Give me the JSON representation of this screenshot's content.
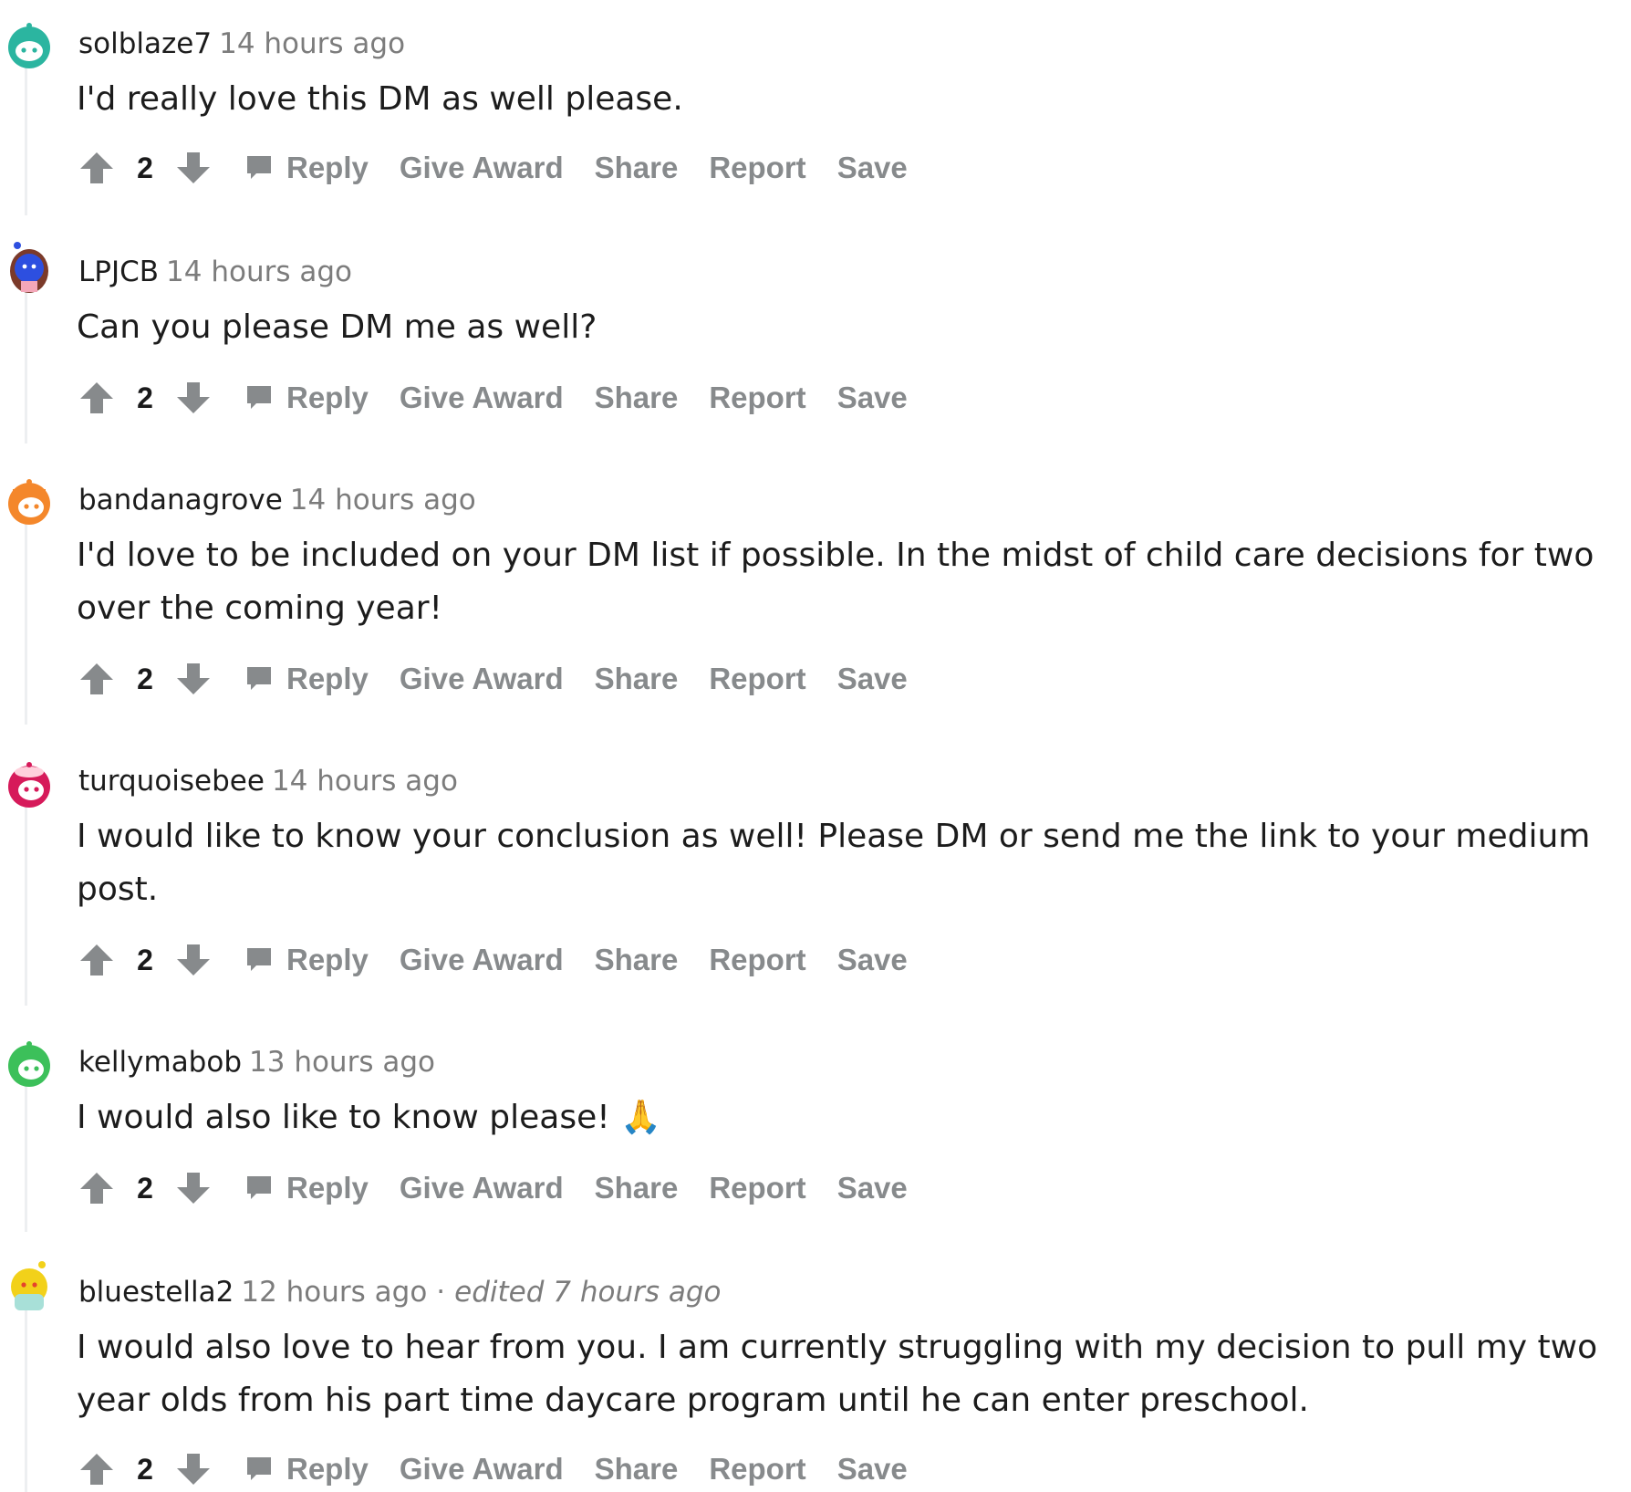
{
  "actions": {
    "reply": "Reply",
    "give_award": "Give Award",
    "share": "Share",
    "report": "Report",
    "save": "Save"
  },
  "comments": [
    {
      "author": "solblaze7",
      "time": "14 hours ago",
      "body_lines": [
        "I'd really love this DM as well please."
      ],
      "score": "2",
      "avatar_color": "#2bb5a0",
      "avatar_icon": "snoo-avatar-teal"
    },
    {
      "author": "LPJCB",
      "time": "14 hours ago",
      "body_lines": [
        "Can you please DM me as well?"
      ],
      "score": "2",
      "avatar_color": "#2d4fe0",
      "avatar_icon": "snoo-avatar-blue"
    },
    {
      "author": "bandanagrove",
      "time": "14 hours ago",
      "body_lines": [
        "I'd love to be included on your DM list if possible. In the midst of child care decisions for two",
        "over the coming year!"
      ],
      "score": "2",
      "avatar_color": "#f4872b",
      "avatar_icon": "snoo-avatar-orange"
    },
    {
      "author": "turquoisebee",
      "time": "14 hours ago",
      "body_lines": [
        "I would like to know your conclusion as well! Please DM or send me the link to your medium",
        "post."
      ],
      "score": "2",
      "avatar_color": "#d61a5a",
      "avatar_icon": "snoo-avatar-pink"
    },
    {
      "author": "kellymabob",
      "time": "13 hours ago",
      "body_lines": [
        "I would also like to know please! 🙏"
      ],
      "score": "2",
      "avatar_color": "#3cc05a",
      "avatar_icon": "snoo-avatar-green"
    },
    {
      "author": "bluestella2",
      "time": "12 hours ago",
      "separator": "·",
      "edited": "edited 7 hours ago",
      "body_lines": [
        "I would also love to hear from you. I am currently struggling with my decision to pull my two",
        "year olds from his part time daycare program until he can enter preschool."
      ],
      "score": "2",
      "avatar_color": "#f2d11a",
      "avatar_icon": "snoo-avatar-yellow"
    }
  ],
  "colors": {
    "meta_gray": "#7c7c7c",
    "action_gray": "#878a8c",
    "thread_line": "#edeff1",
    "text": "#1c1c1c"
  }
}
